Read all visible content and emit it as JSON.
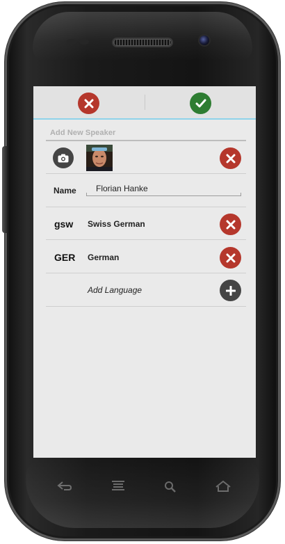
{
  "action_bar": {
    "cancel_icon": "close-icon",
    "confirm_icon": "check-icon"
  },
  "form": {
    "section_title": "Add New Speaker",
    "photo": {
      "camera_icon": "camera-icon",
      "remove_icon": "close-icon"
    },
    "name_label": "Name",
    "name_value": "Florian Hanke",
    "languages": [
      {
        "code": "gsw",
        "name": "Swiss German",
        "remove_icon": "close-icon"
      },
      {
        "code": "GER",
        "name": "German",
        "remove_icon": "close-icon"
      }
    ],
    "add_language_label": "Add Language",
    "add_language_icon": "plus-icon"
  },
  "device_keys": [
    "back-icon",
    "menu-icon",
    "search-icon",
    "home-icon"
  ],
  "colors": {
    "accent_line": "#8fd3ea",
    "cancel_red": "#b5372c",
    "confirm_green": "#2e7d32",
    "dark_button": "#454545",
    "screen_bg": "#eaeaea"
  }
}
